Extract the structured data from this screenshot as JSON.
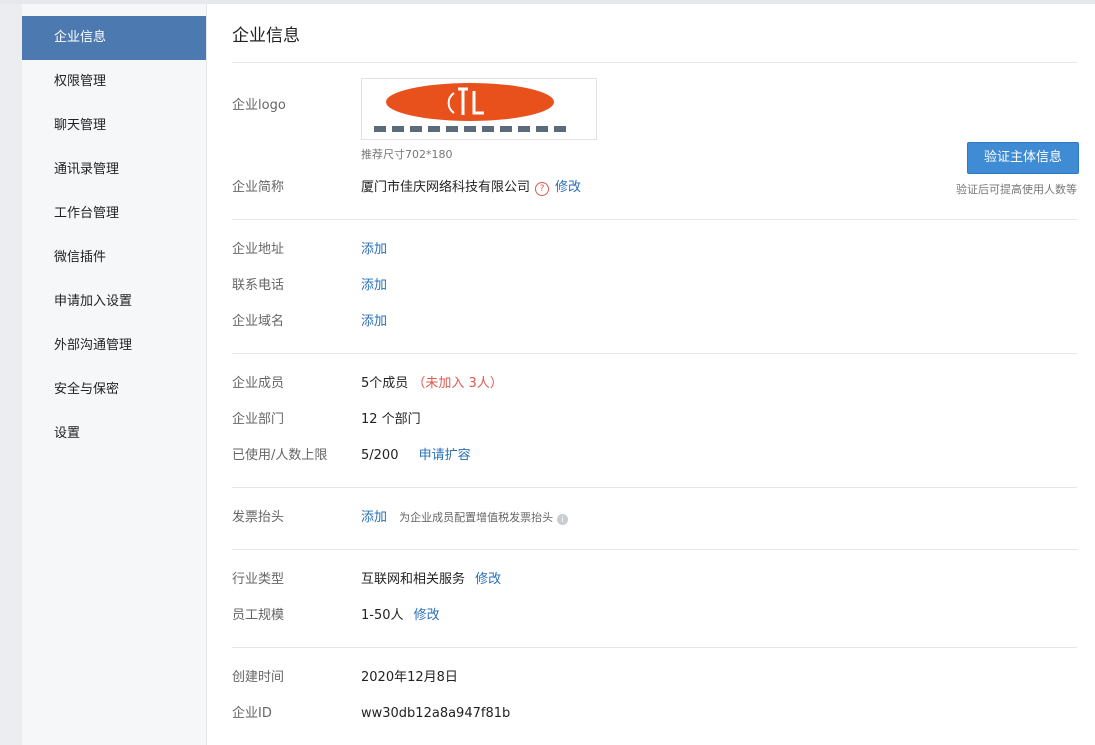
{
  "sidebar": {
    "items": [
      {
        "label": "企业信息",
        "active": true
      },
      {
        "label": "权限管理"
      },
      {
        "label": "聊天管理"
      },
      {
        "label": "通讯录管理"
      },
      {
        "label": "工作台管理"
      },
      {
        "label": "微信插件"
      },
      {
        "label": "申请加入设置"
      },
      {
        "label": "外部沟通管理"
      },
      {
        "label": "安全与保密"
      },
      {
        "label": "设置"
      }
    ]
  },
  "main": {
    "title": "企业信息",
    "logo": {
      "label": "企业logo",
      "caption": "推荐尺寸702*180",
      "brand_color": "#e8511b"
    },
    "verify": {
      "button": "验证主体信息",
      "tip": "验证后可提高使用人数等"
    },
    "short_name": {
      "label": "企业简称",
      "value": "厦门市佳庆网络科技有限公司",
      "help_icon": "question-circle-icon",
      "action": "修改"
    },
    "address": {
      "label": "企业地址",
      "action": "添加"
    },
    "phone": {
      "label": "联系电话",
      "action": "添加"
    },
    "domain": {
      "label": "企业域名",
      "action": "添加"
    },
    "members": {
      "label": "企业成员",
      "value": "5个成员",
      "pending": "（未加入 3人）"
    },
    "departments": {
      "label": "企业部门",
      "value": "12 个部门"
    },
    "usage": {
      "label": "已使用/人数上限",
      "value": "5/200",
      "action": "申请扩容"
    },
    "invoice": {
      "label": "发票抬头",
      "action": "添加",
      "hint": "为企业成员配置增值税发票抬头",
      "info_icon": "info-icon"
    },
    "industry": {
      "label": "行业类型",
      "value": "互联网和相关服务",
      "action": "修改"
    },
    "scale": {
      "label": "员工规模",
      "value": "1-50人",
      "action": "修改"
    },
    "created": {
      "label": "创建时间",
      "value": "2020年12月8日"
    },
    "corp_id": {
      "label": "企业ID",
      "value": "ww30db12a8a947f81b"
    }
  }
}
